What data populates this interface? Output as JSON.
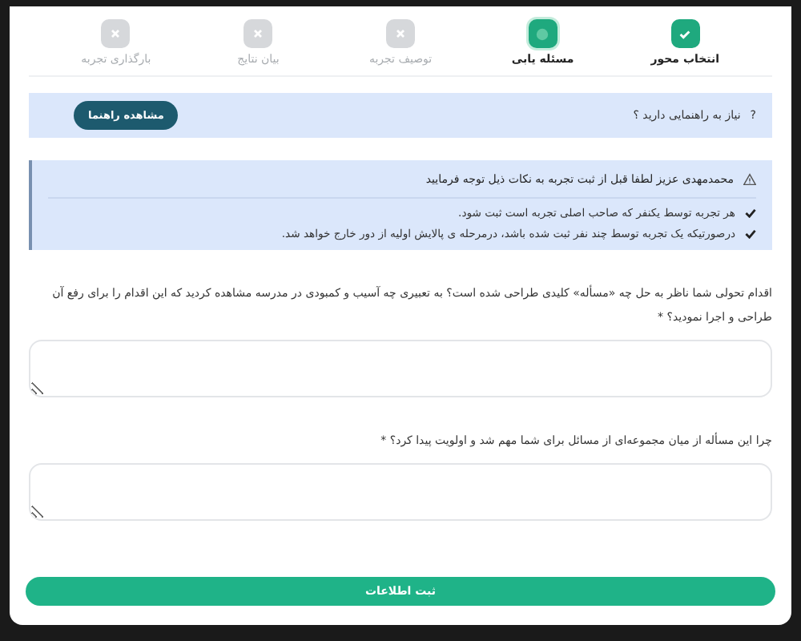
{
  "steps": [
    {
      "label": "انتخاب محور",
      "done": true,
      "selected": false
    },
    {
      "label": "مسئله یابی",
      "done": false,
      "selected": true
    },
    {
      "label": "توصیف تجربه",
      "done": false,
      "selected": false
    },
    {
      "label": "بیان نتایج",
      "done": false,
      "selected": false
    },
    {
      "label": "بارگذاری تجربه",
      "done": false,
      "selected": false
    }
  ],
  "help": {
    "icon": "?",
    "text": "نیاز به راهنمایی دارید ؟",
    "button": "مشاهده راهنما"
  },
  "notice": {
    "title": "محمدمهدی عزیز لطفا قبل از ثبت تجربه به نکات ذیل توجه فرمایید",
    "items": [
      "هر تجربه توسط یکنفر که صاحب اصلی تجربه است ثبت شود.",
      "درصورتیکه یک تجربه توسط چند نفر ثبت شده باشد، درمرحله ی پالایش اولیه از دور خارج خواهد شد."
    ]
  },
  "questions": [
    {
      "label": "اقدام تحولی شما ناظر به حل چه «مسأله» کلیدی طراحی شده است؟ به تعبیری چه آسیب و کمبودی در مدرسه مشاهده کردید که این اقدام را برای رفع آن طراحی و اجرا نمودید؟",
      "required_mark": "*"
    },
    {
      "label": "چرا این مسأله از میان مجموعه‌ای از مسائل برای شما مهم شد و اولویت پیدا کرد؟",
      "required_mark": "*"
    }
  ],
  "submit": "ثبت اطلاعات"
}
